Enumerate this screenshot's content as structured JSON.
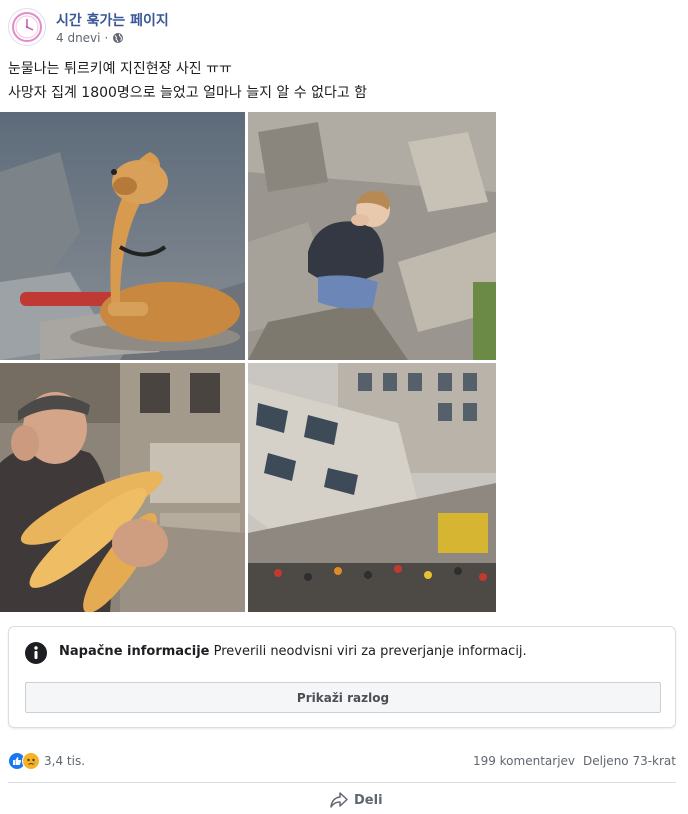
{
  "page": {
    "name": "시간 훅가는 페이지",
    "time_ago": "4 dnevi",
    "separator": "·",
    "audience_icon": "globe-icon"
  },
  "post": {
    "line1": "눈물나는 튀르키예 지진현장 사진 ㅠㅠ",
    "line2": "사망자 집계 1800명으로 늘었고 얼마나 늘지 알 수 없다고 함"
  },
  "photos": [
    {
      "subject": "dog-rubble"
    },
    {
      "subject": "child-crying"
    },
    {
      "subject": "old-man-bread"
    },
    {
      "subject": "collapsed-building"
    }
  ],
  "fact_check": {
    "title": "Napačne informacije",
    "description": "Preverili neodvisni viri za preverjanje informacij.",
    "button_label": "Prikaži razlog",
    "icon": "info-icon"
  },
  "reactions": {
    "count": "3,4 tis.",
    "icons": [
      "like-icon",
      "sad-icon"
    ],
    "like_color": "#1877f2",
    "sad_color": "#f7b125"
  },
  "stats": {
    "comments": "199 komentarjev",
    "shares": "Deljeno 73-krat"
  },
  "actions": {
    "share_label": "Deli"
  }
}
